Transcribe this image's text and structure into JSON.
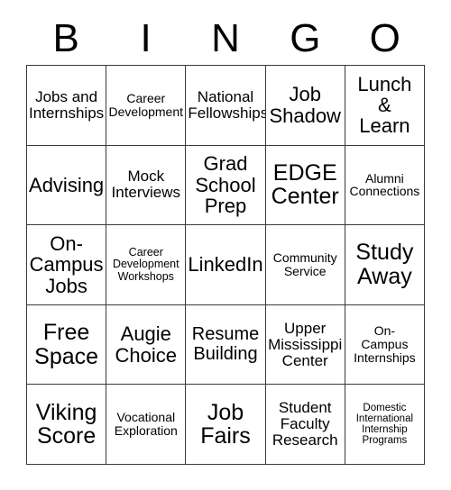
{
  "card": {
    "title": "BINGO",
    "header_letters": [
      "B",
      "I",
      "N",
      "G",
      "O"
    ],
    "border_color": "#3a3a3a",
    "background_color": "#ffffff",
    "text_color": "#000000",
    "columns": 5,
    "rows": 5,
    "cells": [
      {
        "text": "Jobs and\nInternships",
        "size": "md",
        "marked": false
      },
      {
        "text": "Career\nDevelopment",
        "size": "sm",
        "marked": false
      },
      {
        "text": "National\nFellowships",
        "size": "md",
        "marked": false
      },
      {
        "text": "Job\nShadow",
        "size": "xl",
        "marked": false
      },
      {
        "text": "Lunch\n&\nLearn",
        "size": "xl",
        "marked": false
      },
      {
        "text": "Advising",
        "size": "xl",
        "marked": false
      },
      {
        "text": "Mock\nInterviews",
        "size": "md",
        "marked": false
      },
      {
        "text": "Grad\nSchool\nPrep",
        "size": "xl",
        "marked": false
      },
      {
        "text": "EDGE\nCenter",
        "size": "xxl",
        "marked": false
      },
      {
        "text": "Alumni\nConnections",
        "size": "sm",
        "marked": false
      },
      {
        "text": "On-\nCampus\nJobs",
        "size": "xl",
        "marked": false
      },
      {
        "text": "Career\nDevelopment\nWorkshops",
        "size": "xs",
        "marked": false
      },
      {
        "text": "LinkedIn",
        "size": "xl",
        "marked": false
      },
      {
        "text": "Community\nService",
        "size": "sm",
        "marked": false
      },
      {
        "text": "Study\nAway",
        "size": "xxl",
        "marked": false
      },
      {
        "text": "Free\nSpace",
        "size": "xxl",
        "marked": false
      },
      {
        "text": "Augie\nChoice",
        "size": "xl",
        "marked": false
      },
      {
        "text": "Resume\nBuilding",
        "size": "lg",
        "marked": false
      },
      {
        "text": "Upper\nMississippi\nCenter",
        "size": "md",
        "marked": false
      },
      {
        "text": "On-\nCampus\nInternships",
        "size": "sm",
        "marked": false
      },
      {
        "text": "Viking\nScore",
        "size": "xxl",
        "marked": false
      },
      {
        "text": "Vocational\nExploration",
        "size": "sm",
        "marked": false
      },
      {
        "text": "Job\nFairs",
        "size": "xxl",
        "marked": false
      },
      {
        "text": "Student\nFaculty\nResearch",
        "size": "md",
        "marked": false
      },
      {
        "text": "Domestic\nInternational\nInternship\nPrograms",
        "size": "xxs",
        "marked": false
      }
    ]
  }
}
